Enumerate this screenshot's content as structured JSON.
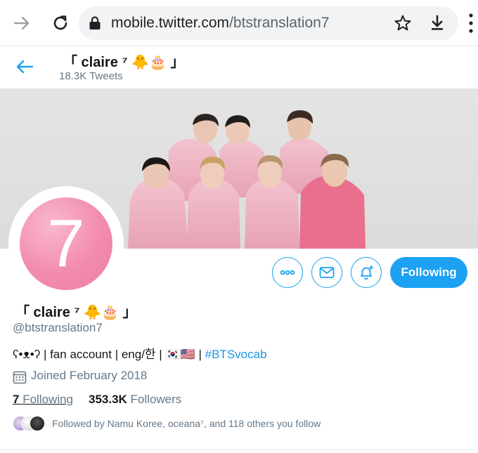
{
  "browser": {
    "url_host": "mobile.twitter.com",
    "url_path": "/btstranslation7"
  },
  "header": {
    "name": "「 claire ⁷ 🐥🎂 」",
    "tweet_count": "18.3K Tweets"
  },
  "avatar": {
    "numeral": "7"
  },
  "actions": {
    "more_icon": "more-icon",
    "message_icon": "mail-icon",
    "notify_icon": "bell-plus-icon",
    "follow_label": "Following"
  },
  "profile": {
    "display_name": "「 claire ⁷ 🐥🎂 」",
    "handle": "@btstranslation7",
    "bio_text": "ʕ•ᴥ•ʔ | fan account | eng/한 | 🇰🇷🇺🇸 | ",
    "bio_hashtag": "#BTSvocab",
    "joined": "Joined February 2018",
    "following_count": "7",
    "following_label": " Following",
    "followers_count": "353.3K",
    "followers_label": " Followers",
    "followed_by": "Followed by Namu Koree, oceana⁷, and 118 others you follow"
  },
  "colors": {
    "accent": "#1da1f2",
    "avatar_pink": "#f28bb0",
    "muted_text": "#657786"
  }
}
